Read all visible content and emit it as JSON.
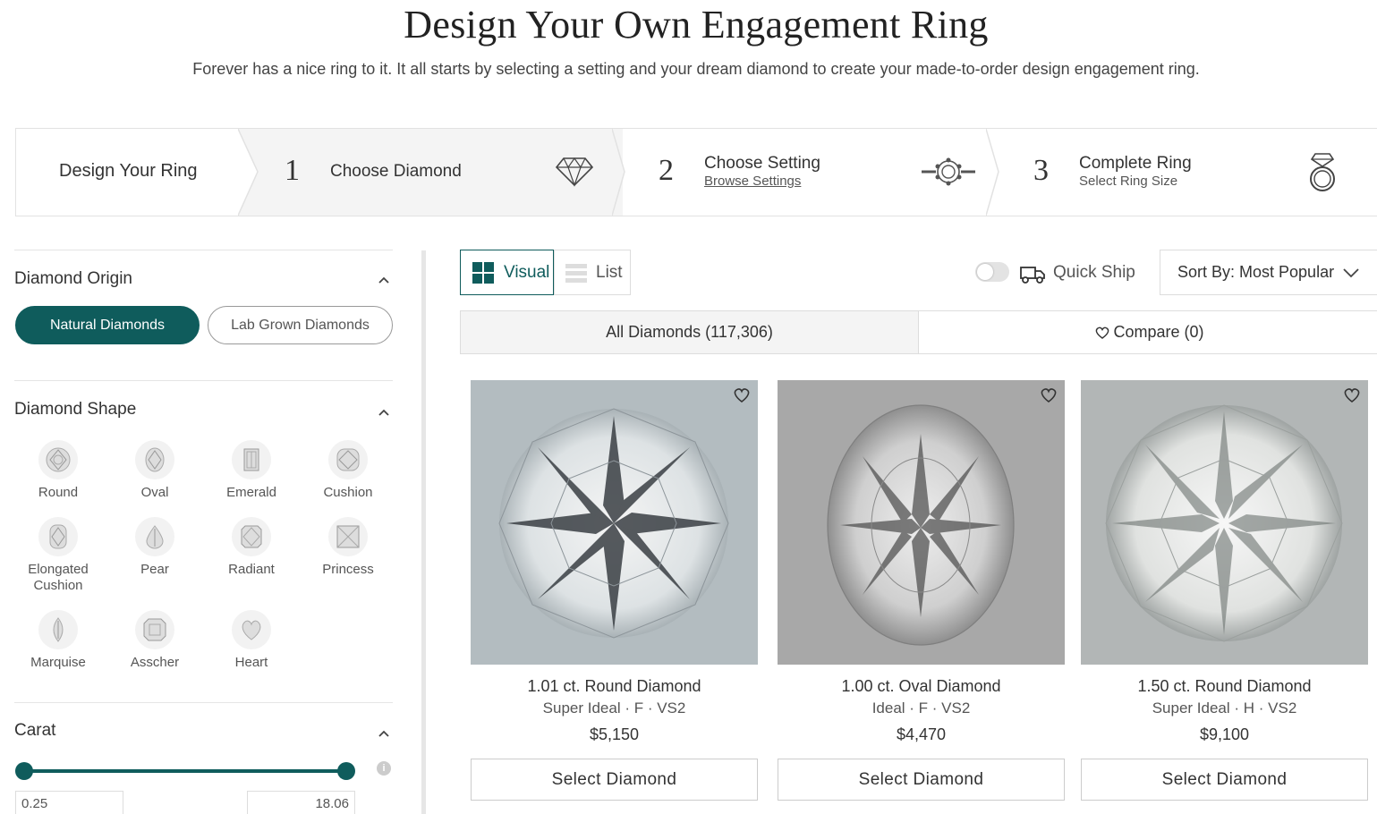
{
  "hero": {
    "title": "Design Your Own Engagement Ring",
    "subtitle": "Forever has a nice ring to it. It all starts by selecting a setting and your dream diamond to create your made-to-order design engagement ring."
  },
  "steps": {
    "intro": "Design Your Ring",
    "items": [
      {
        "number": "1",
        "title": "Choose Diamond",
        "icon": "diamond-icon"
      },
      {
        "number": "2",
        "title": "Choose Setting",
        "link": "Browse Settings",
        "icon": "setting-icon"
      },
      {
        "number": "3",
        "title": "Complete Ring",
        "subtext": "Select Ring Size",
        "icon": "ring-icon"
      }
    ]
  },
  "filters": {
    "origin": {
      "title": "Diamond Origin",
      "options": [
        "Natural Diamonds",
        "Lab Grown Diamonds"
      ],
      "selected": "Natural Diamonds"
    },
    "shape": {
      "title": "Diamond Shape",
      "items": [
        {
          "label": "Round",
          "icon": "round-shape-icon"
        },
        {
          "label": "Oval",
          "icon": "oval-shape-icon"
        },
        {
          "label": "Emerald",
          "icon": "emerald-shape-icon"
        },
        {
          "label": "Cushion",
          "icon": "cushion-shape-icon"
        },
        {
          "label": "Elongated Cushion",
          "icon": "elongated-cushion-shape-icon"
        },
        {
          "label": "Pear",
          "icon": "pear-shape-icon"
        },
        {
          "label": "Radiant",
          "icon": "radiant-shape-icon"
        },
        {
          "label": "Princess",
          "icon": "princess-shape-icon"
        },
        {
          "label": "Marquise",
          "icon": "marquise-shape-icon"
        },
        {
          "label": "Asscher",
          "icon": "asscher-shape-icon"
        },
        {
          "label": "Heart",
          "icon": "heart-shape-icon"
        }
      ]
    },
    "carat": {
      "title": "Carat",
      "min": "0.25",
      "max": "18.06"
    }
  },
  "toolbar": {
    "visual_label": "Visual",
    "list_label": "List",
    "active_view": "Visual",
    "quick_ship_label": "Quick Ship",
    "quick_ship_on": false,
    "sort_label": "Sort By: Most Popular"
  },
  "tabs": {
    "all": "All Diamonds (117,306)",
    "compare": "Compare (0)"
  },
  "products": [
    {
      "name": "1.01 ct. Round Diamond",
      "grade": "Super Ideal · F · VS2",
      "price": "$5,150",
      "button": "Select Diamond",
      "shape": "round"
    },
    {
      "name": "1.00 ct. Oval Diamond",
      "grade": "Ideal · F · VS2",
      "price": "$4,470",
      "button": "Select Diamond",
      "shape": "oval"
    },
    {
      "name": "1.50 ct. Round Diamond",
      "grade": "Super Ideal · H · VS2",
      "price": "$9,100",
      "button": "Select Diamond",
      "shape": "round"
    }
  ],
  "colors": {
    "accent": "#0f5c5c",
    "card_bg_1": "#b3bcc0",
    "card_bg_2": "#a8a8a8",
    "card_bg_3": "#b2b6b6"
  }
}
